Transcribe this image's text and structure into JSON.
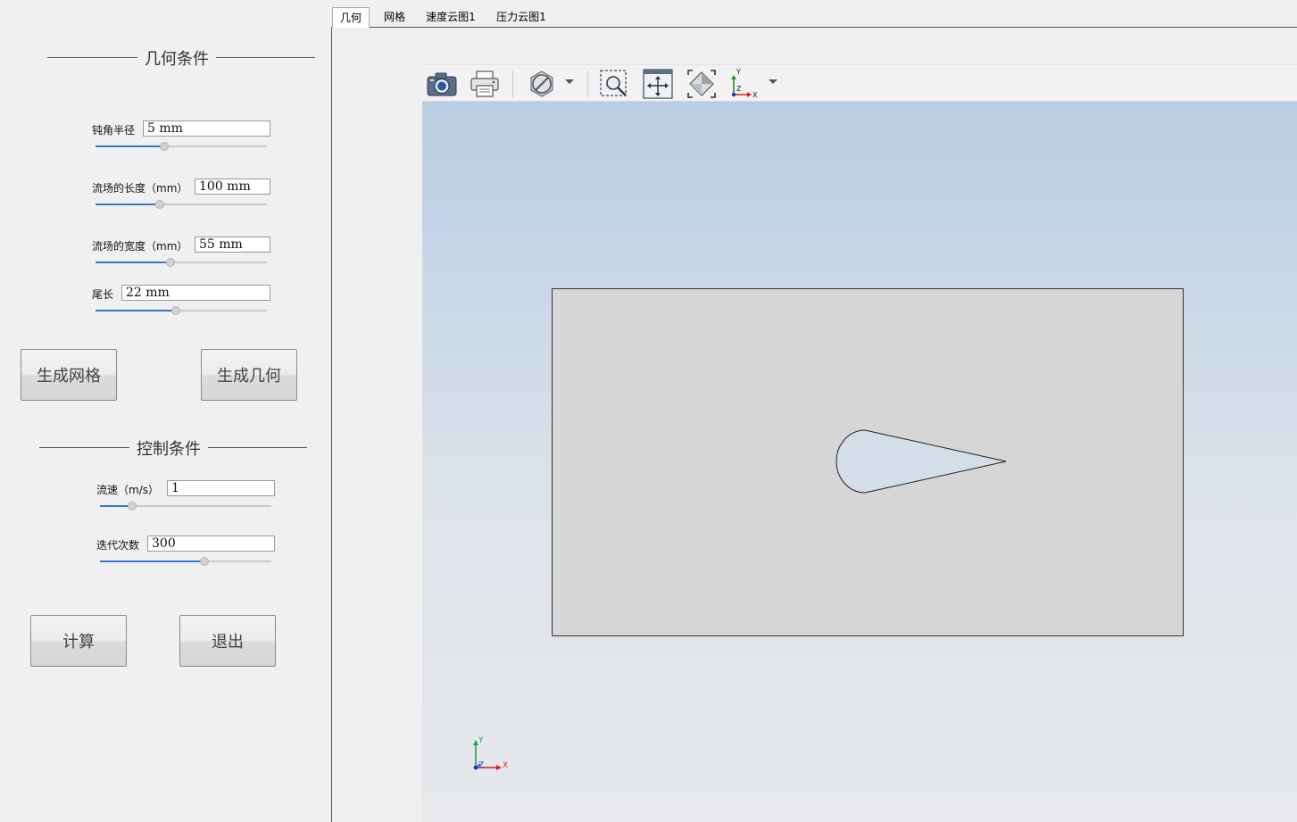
{
  "geometry_section": {
    "title": "几何条件",
    "params": [
      {
        "label": "钝角半径",
        "value": "5  mm",
        "slider": 0.4
      },
      {
        "label": "流场的长度（mm）",
        "value": "100  mm",
        "slider": 0.375
      },
      {
        "label": "流场的宽度（mm）",
        "value": "55  mm",
        "slider": 0.44
      },
      {
        "label": "尾长",
        "value": "22  mm",
        "slider": 0.47
      }
    ],
    "buttons": {
      "mesh": "生成网格",
      "geometry": "生成几何"
    }
  },
  "control_section": {
    "title": "控制条件",
    "params": [
      {
        "label": "流速（m/s）",
        "value": "1",
        "slider": 0.19
      },
      {
        "label": "迭代次数",
        "value": "300",
        "slider": 0.61
      }
    ],
    "buttons": {
      "compute": "计算",
      "exit": "退出"
    }
  },
  "tabs": [
    {
      "label": "几何",
      "active": true
    },
    {
      "label": "网格",
      "active": false
    },
    {
      "label": "速度云图1",
      "active": false
    },
    {
      "label": "压力云图1",
      "active": false
    }
  ],
  "toolbar": {
    "icons": [
      "camera-icon",
      "print-icon",
      "display-mode-icon",
      "zoom-box-icon",
      "fit-view-icon",
      "reset-view-icon",
      "axes-view-icon"
    ]
  },
  "axes_triad": {
    "x": "X",
    "y": "Y",
    "z": "Z"
  },
  "colors": {
    "slider_fill": "#3a78c8",
    "viewport_top": "#b9cde4",
    "viewport_bottom": "#e6e8eb",
    "domain_fill": "#d6d6d6",
    "body_fill": "#d3dee9"
  }
}
